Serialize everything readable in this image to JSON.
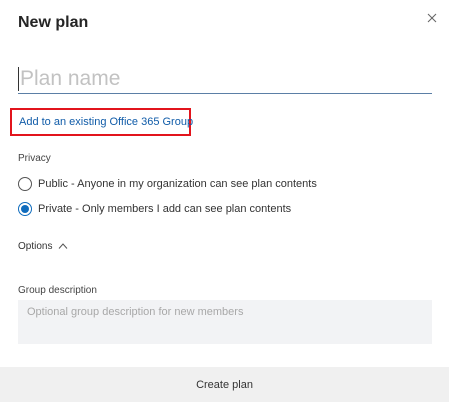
{
  "dialog": {
    "title": "New plan",
    "close_icon": "close-icon"
  },
  "plan_name": {
    "value": "",
    "placeholder": "Plan name"
  },
  "group_link": {
    "label": "Add to an existing Office 365 Group"
  },
  "privacy": {
    "label": "Privacy",
    "options": [
      {
        "label": "Public - Anyone in my organization can see plan contents",
        "checked": false
      },
      {
        "label": "Private - Only members I add can see plan contents",
        "checked": true
      }
    ]
  },
  "options_section": {
    "label": "Options",
    "expanded": true,
    "icon": "chevron-up-icon"
  },
  "group_description": {
    "label": "Group description",
    "value": "",
    "placeholder": "Optional group description for new members"
  },
  "footer": {
    "create_label": "Create plan"
  },
  "colors": {
    "link": "#0f5ba8",
    "highlight_border": "#e2141c",
    "radio_accent": "#0f6cbd",
    "footer_bg": "#f0f0f0"
  }
}
